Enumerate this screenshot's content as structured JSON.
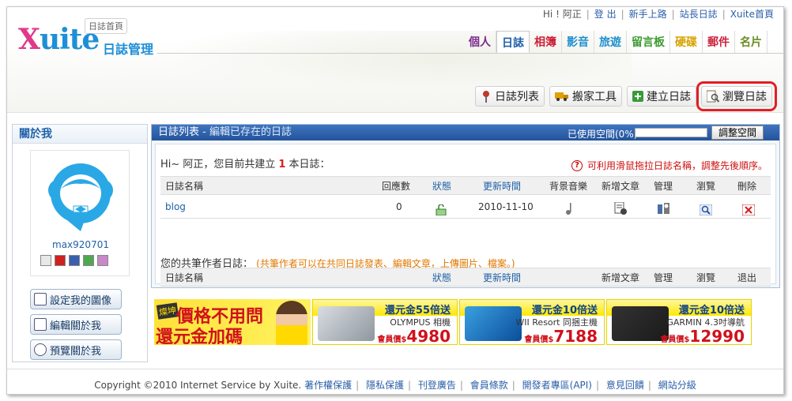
{
  "logo": {
    "word": "Xuite",
    "sub_label": "日誌首頁",
    "section_title": "日誌管理"
  },
  "toplinks": [
    {
      "label": "Hi ! 阿正"
    },
    {
      "label": "登 出"
    },
    {
      "label": "新手上路"
    },
    {
      "label": "站長日誌"
    },
    {
      "label": "Xuite首頁"
    }
  ],
  "mainnav": [
    {
      "label": "個人",
      "color": "#7a2b8c"
    },
    {
      "label": "日誌",
      "color": "#1e60a8",
      "active": true
    },
    {
      "label": "相簿",
      "color": "#cc1f3a"
    },
    {
      "label": "影音",
      "color": "#1f8fd0"
    },
    {
      "label": "旅遊",
      "color": "#1f8fd0"
    },
    {
      "label": "留言板",
      "color": "#3b9a2f"
    },
    {
      "label": "硬碟",
      "color": "#d6a300"
    },
    {
      "label": "郵件",
      "color": "#cc1f3a"
    },
    {
      "label": "名片",
      "color": "#6b8e23"
    }
  ],
  "tools": [
    {
      "label": "日誌列表",
      "icon": "pin-icon",
      "color": "#c0392b"
    },
    {
      "label": "搬家工具",
      "icon": "truck-icon",
      "color": "#e0a000"
    },
    {
      "label": "建立日誌",
      "icon": "plus-icon",
      "color": "#3a9a3a"
    },
    {
      "label": "瀏覽日誌",
      "icon": "browse-icon",
      "color": "#7a6a4a"
    }
  ],
  "sidebar": {
    "title": "關於我",
    "username": "max920701",
    "buttons": [
      {
        "label": "設定我的圖像"
      },
      {
        "label": "編輯關於我"
      },
      {
        "label": "預覽關於我"
      }
    ]
  },
  "panel": {
    "title": "日誌列表",
    "subtitle": " - 編輯已存在的日誌",
    "usage_label": "已使用空間(0%)",
    "adjust_label": "調整空間",
    "greeting_pre": "Hi~ 阿正，您目前共建立",
    "count": "1",
    "greeting_post": "本日誌：",
    "tip": "可利用滑鼠拖拉日誌名稱，調整先後順序。",
    "headers": {
      "name": "日誌名稱",
      "replies": "回應數",
      "status": "狀態",
      "updated": "更新時間",
      "music": "背景音樂",
      "new_post": "新增文章",
      "manage": "管理",
      "browse": "瀏覽",
      "delete": "刪除"
    },
    "rows": [
      {
        "name": "blog",
        "replies": "0",
        "updated": "2010-11-10"
      }
    ],
    "coauthor_label": "您的共筆作者日誌：",
    "coauthor_note": "(共筆作者可以在共同日誌發表、編輯文章，上傳圖片、檔案。)",
    "headers2": {
      "name": "日誌名稱",
      "status": "狀態",
      "updated": "更新時間",
      "new_post": "新增文章",
      "manage": "管理",
      "browse": "瀏覽",
      "leave": "退出"
    }
  },
  "ads": {
    "banner_tag": "燦坤",
    "banner_line1": "價格不用問",
    "banner_line2": "還元金加碼",
    "items": [
      {
        "headline": "還元金55倍送",
        "product": "OLYMPUS 相機",
        "price_label": "會員價$",
        "price": "4980"
      },
      {
        "headline": "還元金10倍送",
        "product": "WII Resort 同捆主機",
        "price_label": "會員價$",
        "price": "7188"
      },
      {
        "headline": "還元金10倍送",
        "product": "GARMIN 4.3吋導航",
        "price_label": "會員價$",
        "price": "12990"
      }
    ]
  },
  "footer": {
    "copyright": "Copyright ©2010 Internet Service by Xuite.",
    "links": [
      "著作權保護",
      "隱私保護",
      "刊登廣告",
      "會員條款",
      "開發者專區(API)",
      "意見回饋",
      "網站分級"
    ]
  }
}
